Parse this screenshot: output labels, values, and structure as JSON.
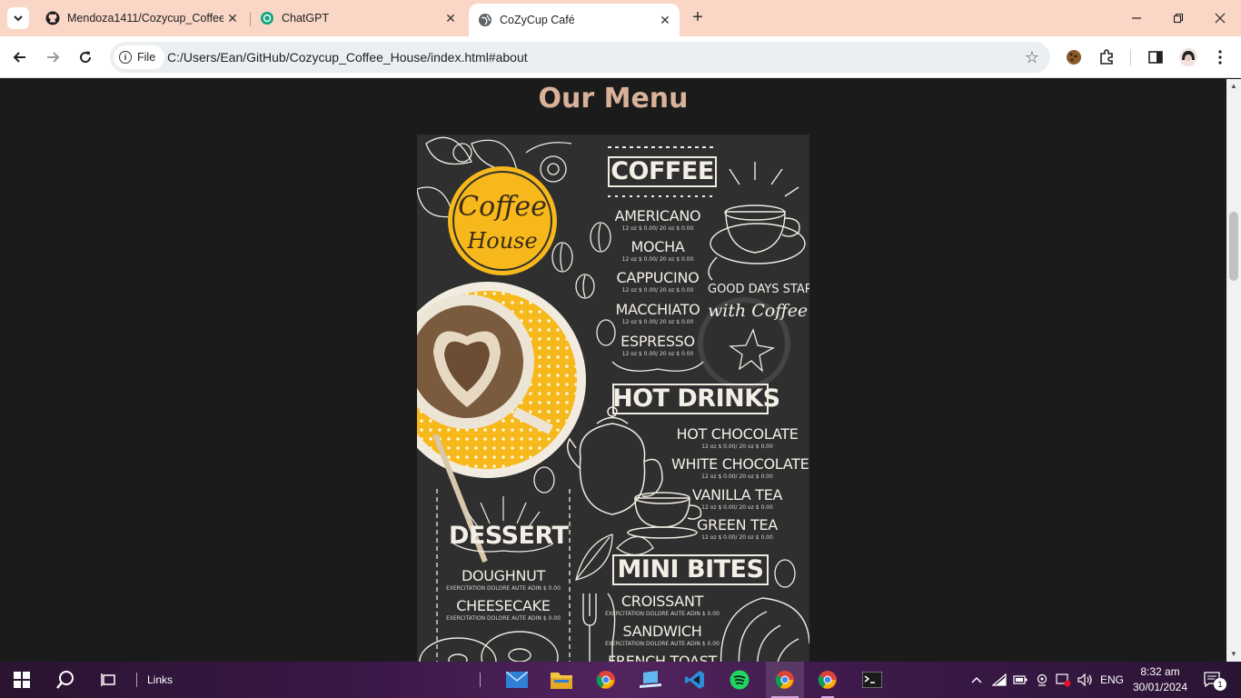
{
  "browser": {
    "tabs": [
      {
        "title": "Mendoza1411/Cozycup_Coffee",
        "icon": "github-icon"
      },
      {
        "title": "ChatGPT",
        "icon": "chatgpt-icon"
      },
      {
        "title": "CoZyCup Café",
        "icon": "globe-icon",
        "active": true
      }
    ],
    "chip_label": "File",
    "url": "C:/Users/Ean/GitHub/Cozycup_Coffee_House/index.html#about"
  },
  "page": {
    "section_title": "Our Menu",
    "menu_image": {
      "logo_line1": "Coffee",
      "logo_line2": "House",
      "coffee_heading": "COFFEE",
      "coffee_items": [
        {
          "name": "AMERICANO",
          "price": "12 oz $ 0.00/ 20 oz $ 0.00"
        },
        {
          "name": "MOCHA",
          "price": "12 oz $ 0.00/ 20 oz $ 0.00"
        },
        {
          "name": "CAPPUCINO",
          "price": "12 oz $ 0.00/ 20 oz $ 0.00"
        },
        {
          "name": "MACCHIATO",
          "price": "12 oz $ 0.00/ 20 oz $ 0.00"
        },
        {
          "name": "ESPRESSO",
          "price": "12 oz $ 0.00/ 20 oz $ 0.00"
        }
      ],
      "slogan_line1": "GOOD DAYS START",
      "slogan_line2": "with Coffee",
      "hot_heading": "HOT DRINKS",
      "hot_items": [
        {
          "name": "HOT CHOCOLATE",
          "price": "12 oz $ 0.00/ 20 oz $ 0.00"
        },
        {
          "name": "WHITE CHOCOLATE",
          "price": "12 oz $ 0.00/ 20 oz $ 0.00"
        },
        {
          "name": "VANILLA TEA",
          "price": "12 oz $ 0.00/ 20 oz $ 0.00"
        },
        {
          "name": "GREEN TEA",
          "price": "12 oz $ 0.00/ 20 oz $ 0.00"
        }
      ],
      "dessert_heading": "DESSERT",
      "dessert_items": [
        {
          "name": "DOUGHNUT",
          "price": "EXERCITATION DOLORE AUTE ADIN $ 0.00"
        },
        {
          "name": "CHEESECAKE",
          "price": "EXERCITATION DOLORE AUTE ADIN $ 0.00"
        }
      ],
      "bites_heading": "MINI BITES",
      "bites_items": [
        {
          "name": "CROISSANT",
          "price": "EXERCITATION DOLORE AUTE ADIN $ 0.00"
        },
        {
          "name": "SANDWICH",
          "price": "EXERCITATION DOLORE AUTE ADIN $ 0.00"
        },
        {
          "name": "FRENCH TOAST",
          "price": ""
        }
      ]
    }
  },
  "taskbar": {
    "toolbar_label": "Links",
    "language": "ENG",
    "time": "8:32 am",
    "date": "30/01/2024",
    "notification_count": "1"
  },
  "colors": {
    "tab_strip": "#f9d6c6",
    "page_bg": "#1b1b1b",
    "heading": "#d9b29a",
    "board": "#2e2e2e",
    "accent_yellow": "#f6b81a"
  }
}
